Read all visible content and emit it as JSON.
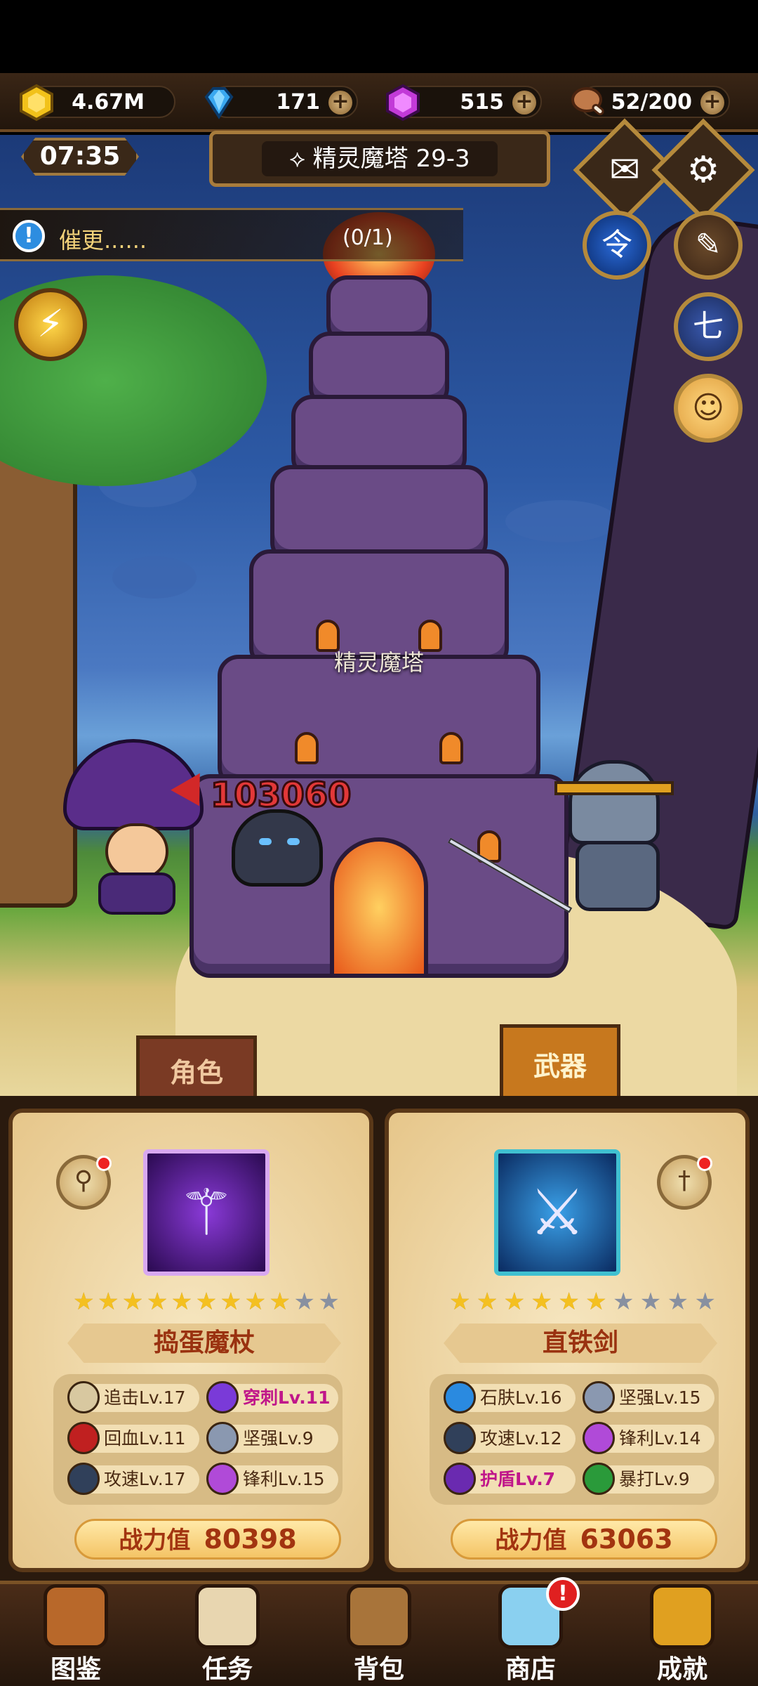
{
  "resources": {
    "gold": {
      "value": "4.67M",
      "icon": "gold-coin-icon",
      "color": "#f2c21a"
    },
    "diamond": {
      "value": "171",
      "icon": "blue-diamond-icon",
      "color": "#3aa8f0"
    },
    "gem": {
      "value": "515",
      "icon": "purple-gem-icon",
      "color": "#c23ad8"
    },
    "stamina": {
      "value": "52/200",
      "icon": "meat-icon",
      "color": "#c07a4a"
    },
    "plus": "+"
  },
  "hud": {
    "timer": "07:35",
    "stage_title": "精灵魔塔 29-3",
    "stage_marker": "⟡",
    "quest_text": "催更......",
    "quest_count": "(0/1)",
    "quest_icon": "!",
    "tower_label": "精灵魔塔",
    "damage": "103060"
  },
  "side_buttons": {
    "mail": "✉",
    "settings": "⚙",
    "order": "令",
    "feather": "✎",
    "scroll": "七",
    "avatar": "☺",
    "bolt": "⚡"
  },
  "book": {
    "left": {
      "tab": "角色",
      "name": "捣蛋魔杖",
      "stars_on": 9,
      "stars_total": 11,
      "stats": [
        {
          "label": "追击Lv.17",
          "color": "#d8c8a0",
          "hl": false
        },
        {
          "label": "穿刺Lv.11",
          "color": "#7a3ad8",
          "hl": true
        },
        {
          "label": "回血Lv.11",
          "color": "#c02020",
          "hl": false
        },
        {
          "label": "坚强Lv.9",
          "color": "#8a98b0",
          "hl": false
        },
        {
          "label": "攻速Lv.17",
          "color": "#30405a",
          "hl": false
        },
        {
          "label": "锋利Lv.15",
          "color": "#b04ad8",
          "hl": false
        }
      ],
      "power_label": "战力值",
      "power_value": "80398"
    },
    "right": {
      "tab": "武器",
      "name": "直铁剑",
      "stars_on": 6,
      "stars_total": 10,
      "stats": [
        {
          "label": "石肤Lv.16",
          "color": "#2a8ae0",
          "hl": false
        },
        {
          "label": "坚强Lv.15",
          "color": "#8a98b0",
          "hl": false
        },
        {
          "label": "攻速Lv.12",
          "color": "#30405a",
          "hl": false
        },
        {
          "label": "锋利Lv.14",
          "color": "#b04ad8",
          "hl": false
        },
        {
          "label": "护盾Lv.7",
          "color": "#6a2ab0",
          "hl": true
        },
        {
          "label": "暴打Lv.9",
          "color": "#2a9a3a",
          "hl": false
        }
      ],
      "power_label": "战力值",
      "power_value": "63063"
    }
  },
  "nav": [
    {
      "label": "图鉴",
      "icon": "book-icon",
      "color": "#b8682a",
      "badge": ""
    },
    {
      "label": "任务",
      "icon": "scroll-icon",
      "color": "#e8d6b0",
      "badge": ""
    },
    {
      "label": "背包",
      "icon": "backpack-icon",
      "color": "#a8743a",
      "badge": ""
    },
    {
      "label": "商店",
      "icon": "treasure-chest-icon",
      "color": "#8ad0f0",
      "badge": "!"
    },
    {
      "label": "成就",
      "icon": "trophy-icon",
      "color": "#e0a020",
      "badge": ""
    }
  ]
}
